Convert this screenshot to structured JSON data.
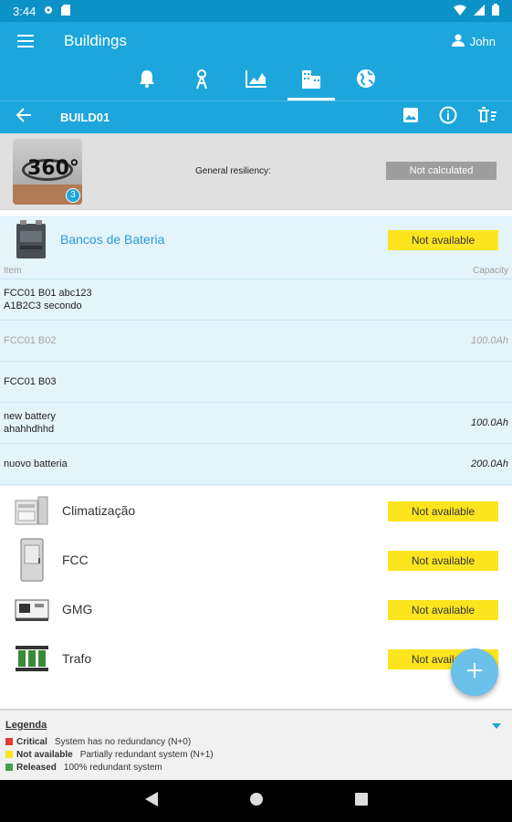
{
  "status_bar": {
    "time": "3:44"
  },
  "app_bar": {
    "title": "Buildings",
    "user": "John"
  },
  "tabs": [
    {
      "icon": "bell-icon"
    },
    {
      "icon": "antenna-icon"
    },
    {
      "icon": "chart-icon"
    },
    {
      "icon": "building-icon",
      "active": true
    },
    {
      "icon": "globe-icon"
    }
  ],
  "building": {
    "code": "BUILD01"
  },
  "info": {
    "thumb_text": "360°",
    "thumb_badge": "3",
    "resiliency_label": "General resiliency:",
    "resiliency_value": "Not calculated"
  },
  "battery": {
    "name": "Bancos de Bateria",
    "status": "Not available",
    "col_item": "Item",
    "col_capacity": "Capacity",
    "rows": [
      {
        "name": "FCC01 B01 abc123",
        "name2": "A1B2C3 secondo",
        "capacity": ""
      },
      {
        "name": "FCC01 B02",
        "name2": "",
        "capacity": "100.0Ah"
      },
      {
        "name": "FCC01 B03",
        "name2": "",
        "capacity": ""
      },
      {
        "name": "new battery",
        "name2": "ahahhdhhd",
        "capacity": "100.0Ah"
      },
      {
        "name": "nuovo batteria",
        "name2": "",
        "capacity": "200.0Ah"
      }
    ]
  },
  "categories": [
    {
      "name": "Climatização",
      "status": "Not available"
    },
    {
      "name": "FCC",
      "status": "Not available"
    },
    {
      "name": "GMG",
      "status": "Not available"
    },
    {
      "name": "Trafo",
      "status": "Not available"
    }
  ],
  "legend": {
    "title": "Legenda",
    "items": [
      {
        "key": "Critical",
        "desc": "System has no redundancy (N+0)",
        "color": "#e53935"
      },
      {
        "key": "Not available",
        "desc": "Partially redundant system (N+1)",
        "color": "#fce51f"
      },
      {
        "key": "Released",
        "desc": "100% redundant system",
        "color": "#43a047"
      }
    ]
  },
  "colors": {
    "primary": "#1ca6dc",
    "status_bar": "#0d92c8",
    "pill": "#fce51f",
    "battery_bg": "#e3f4fb"
  }
}
